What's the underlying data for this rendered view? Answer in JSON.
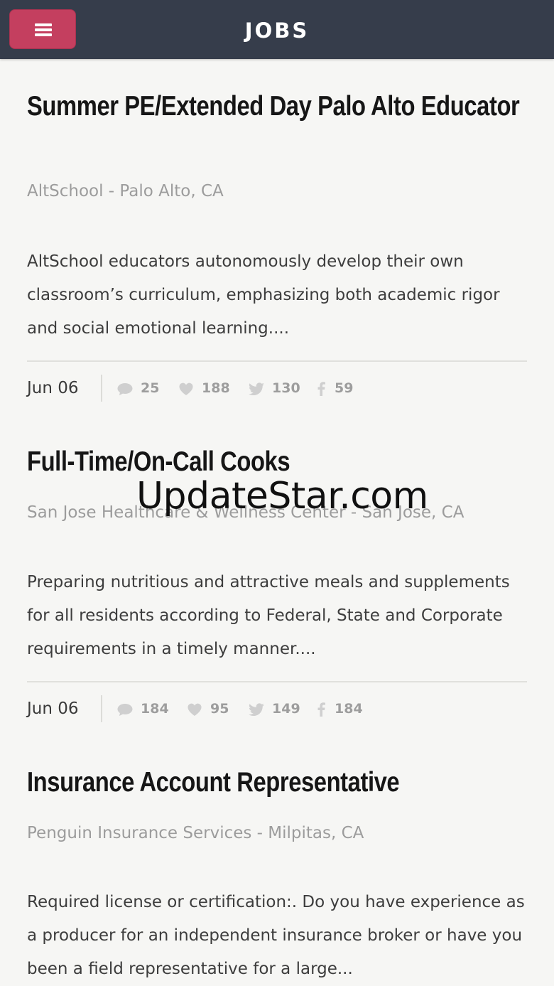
{
  "header": {
    "title": "JOBS",
    "menu_icon": "hamburger-menu-icon"
  },
  "jobs": [
    {
      "title": "Summer PE/Extended Day Palo Alto Educator",
      "company": "AltSchool - Palo Alto, CA",
      "description": "AltSchool educators autonomously develop their own classroom’s curriculum, emphasizing both academic rigor and social emotional learning....",
      "date": "Jun 06",
      "comments": "25",
      "likes": "188",
      "tweets": "130",
      "shares": "59"
    },
    {
      "title": "Full-Time/On-Call Cooks",
      "company": "San Jose Healthcare & Wellness Center - San Jose, CA",
      "description": "Preparing nutritious and attractive meals and supplements for all residents according to Federal, State and Corporate requirements in a timely manner....",
      "date": "Jun 06",
      "comments": "184",
      "likes": "95",
      "tweets": "149",
      "shares": "184"
    },
    {
      "title": "Insurance Account Representative",
      "company": "Penguin Insurance Services - Milpitas, CA",
      "description": "Required license or certification:. Do you have experience as a producer for an independent insurance broker or have you been a field representative for a large...",
      "date": "",
      "comments": "",
      "likes": "",
      "tweets": "",
      "shares": ""
    }
  ],
  "watermark": "UpdateStar.com",
  "colors": {
    "header_bg": "#363d4b",
    "menu_button": "#c43f5f",
    "page_bg": "#f6f6f4",
    "muted_text": "#9c9c9c"
  }
}
